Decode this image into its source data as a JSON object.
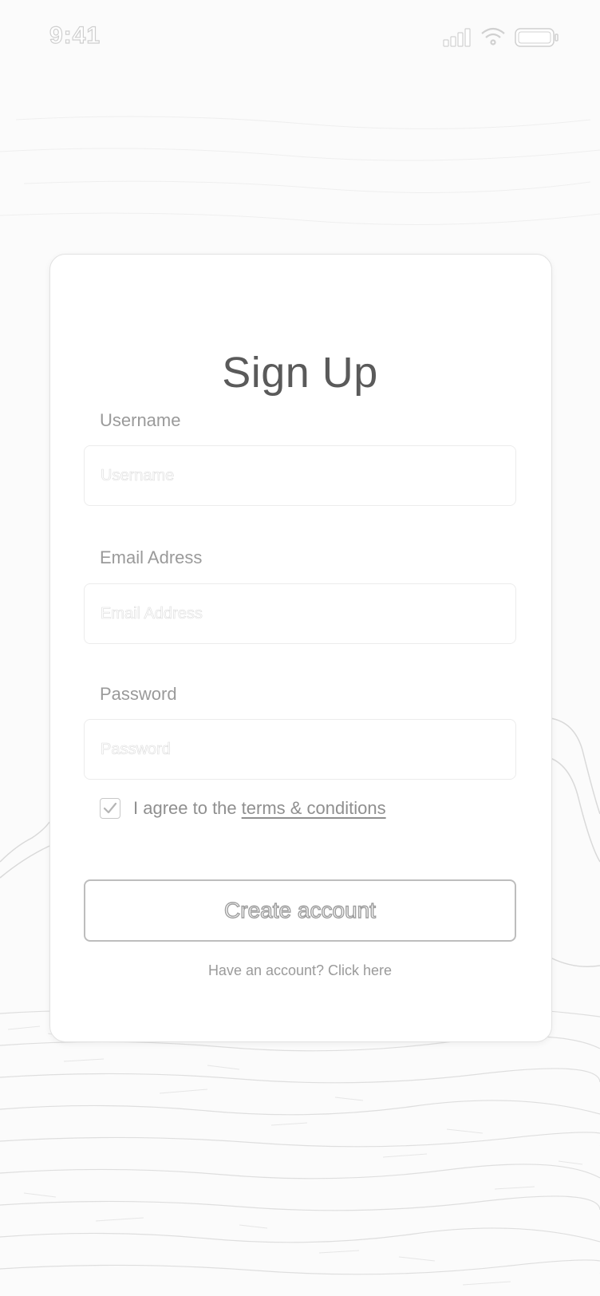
{
  "status_bar": {
    "time": "9:41",
    "icons": [
      "cellular-signal-icon",
      "wifi-icon",
      "battery-icon"
    ]
  },
  "form": {
    "title": "Sign Up",
    "username": {
      "label": "Username",
      "placeholder": "Username",
      "value": ""
    },
    "email": {
      "label": "Email Adress",
      "placeholder": "Email Address",
      "value": ""
    },
    "password": {
      "label": "Password",
      "placeholder": "Password",
      "value": ""
    },
    "agree": {
      "checked": true,
      "text": "I agree to the",
      "link": "terms & conditions"
    },
    "submit_label": "Create account",
    "login_prompt": "Have an account? Click here"
  },
  "colors": {
    "card_bg": "#ffffff",
    "text_primary": "#5a5a5a",
    "text_secondary": "#9a9a9a",
    "border": "#e2e2e2"
  }
}
